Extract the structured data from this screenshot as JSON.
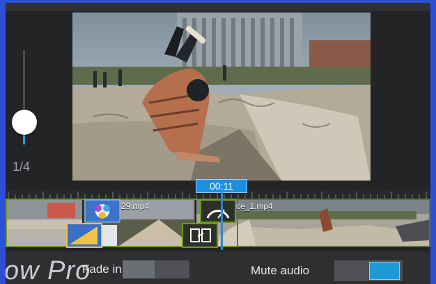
{
  "zoom": {
    "level": "1/4",
    "slider_fraction": 0.2
  },
  "timeline": {
    "current_time": "00:11",
    "clips": [
      {
        "name": "29.mp4"
      },
      {
        "name": "ce_1.mp4"
      }
    ]
  },
  "settings": {
    "fade_in_label": "Fade in",
    "mute_audio_label": "Mute audio",
    "mute_audio_on": true
  },
  "watermark": "ow Pro",
  "colors": {
    "accent": "#1e8fe0",
    "frame": "#2b4fd6",
    "clip_outline": "#6b9a1c"
  }
}
